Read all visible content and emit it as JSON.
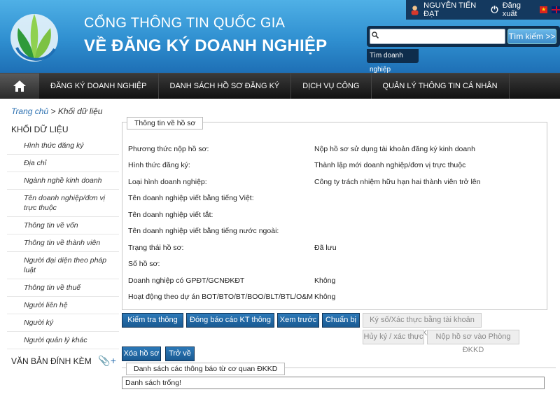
{
  "header": {
    "title_top": "CỔNG THÔNG TIN QUỐC GIA",
    "title_main": "VỀ ĐĂNG KÝ DOANH NGHIỆP"
  },
  "userbar": {
    "user_name": "NGUYỄN TIẾN ĐẠT",
    "logout": "Đăng xuất",
    "flag_vn_star": "★"
  },
  "search": {
    "placeholder": "",
    "button": "Tìm kiếm >>",
    "suggestion": "Tìm doanh nghiệp"
  },
  "nav": {
    "items": [
      "ĐĂNG KÝ DOANH NGHIỆP",
      "DANH SÁCH HỒ SƠ ĐĂNG KÝ",
      "DỊCH VỤ CÔNG",
      "QUẢN LÝ THÔNG TIN CÁ NHÂN"
    ]
  },
  "breadcrumb": {
    "home": "Trang chủ",
    "sep": " > ",
    "current": "Khối dữ liệu"
  },
  "sidebar": {
    "heading": "KHỐI DỮ LIỆU",
    "items": [
      "Hình thức đăng ký",
      "Địa chỉ",
      "Ngành nghề kinh doanh",
      "Tên doanh nghiệp/đơn vị trực thuộc",
      "Thông tin về vốn",
      "Thông tin về thành viên",
      "Người đại diện theo pháp luật",
      "Thông tin về thuế",
      "Người liên hệ",
      "Người ký",
      "Người quản lý khác"
    ],
    "attachments": "VĂN BẢN ĐÍNH KÈM"
  },
  "profile": {
    "legend": "Thông tin về hồ sơ",
    "rows": [
      {
        "label": "Phương thức nộp hồ sơ:",
        "value": "Nộp hồ sơ sử dụng tài khoản đăng ký kinh doanh"
      },
      {
        "label": "Hình thức đăng ký:",
        "value": "Thành lập mới doanh nghiệp/đơn vị trực thuộc"
      },
      {
        "label": "Loại hình doanh nghiệp:",
        "value": "Công ty trách nhiệm hữu hạn hai thành viên trở lên"
      },
      {
        "label": "Tên doanh nghiệp viết bằng tiếng Việt:",
        "value": ""
      },
      {
        "label": "Tên doanh nghiệp viết tắt:",
        "value": ""
      },
      {
        "label": "Tên doanh nghiệp viết bằng tiếng nước ngoài:",
        "value": ""
      },
      {
        "label": "Trạng thái hồ sơ:",
        "value": "Đã lưu"
      },
      {
        "label": "Số hồ sơ:",
        "value": ""
      },
      {
        "label": "Doanh nghiệp có GPĐT/GCNĐKĐT",
        "value": "Không"
      },
      {
        "label": "Hoạt động theo dự án BOT/BTO/BT/BOO/BLT/BTL/O&M",
        "value": "Không"
      }
    ]
  },
  "buttons": {
    "check": "Kiểm tra thông tin",
    "report": "Đóng báo cáo KT thông tin",
    "preview": "Xem trước",
    "prepare": "Chuẩn bị",
    "sign": "Ký số/Xác thực bằng tài khoản ĐKKD",
    "cancel_sign": "Hủy ký / xác thực",
    "submit": "Nộp hồ sơ vào Phòng ĐKKD",
    "delete": "Xóa hồ sơ",
    "back": "Trở về"
  },
  "notices": {
    "legend": "Danh sách các thông báo từ cơ quan ĐKKD",
    "empty": "Danh sách trống!"
  }
}
